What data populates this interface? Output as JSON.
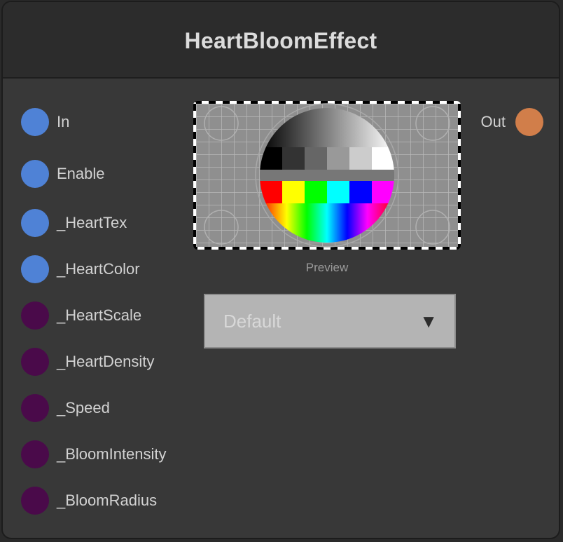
{
  "node": {
    "title": "HeartBloomEffect",
    "inputs": [
      {
        "label": "In",
        "color": "#4f82d6"
      },
      {
        "label": "Enable",
        "color": "#4f82d6"
      },
      {
        "label": "_HeartTex",
        "color": "#4f82d6"
      },
      {
        "label": "_HeartColor",
        "color": "#4f82d6"
      },
      {
        "label": "_HeartScale",
        "color": "#4a0a4a"
      },
      {
        "label": "_HeartDensity",
        "color": "#4a0a4a"
      },
      {
        "label": "_Speed",
        "color": "#4a0a4a"
      },
      {
        "label": "_BloomIntensity",
        "color": "#4a0a4a"
      },
      {
        "label": "_BloomRadius",
        "color": "#4a0a4a"
      }
    ],
    "output": {
      "label": "Out",
      "color": "#d17e4a"
    },
    "preview_label": "Preview",
    "dropdown": {
      "value": "Default",
      "arrow_icon": "triangle-down-icon"
    }
  }
}
